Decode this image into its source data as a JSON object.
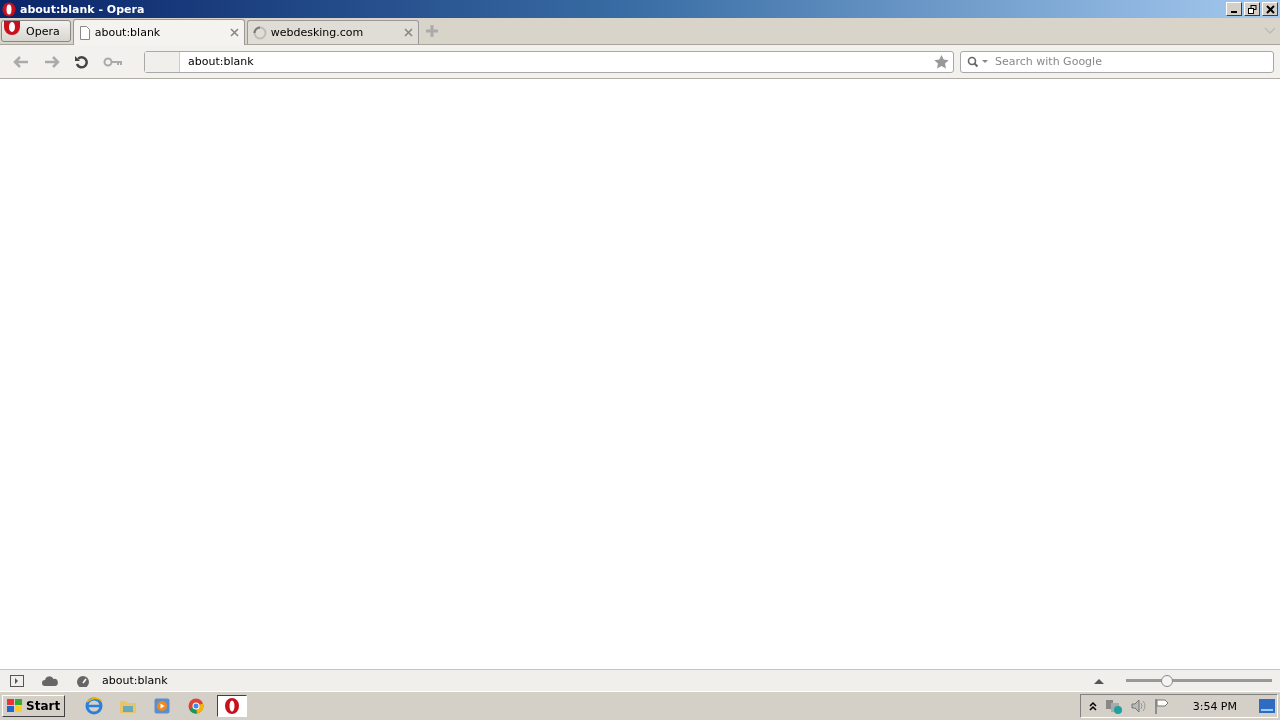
{
  "window": {
    "title": "about:blank - Opera"
  },
  "menu_button": {
    "label": "Opera"
  },
  "tabs": [
    {
      "title": "about:blank",
      "kind": "page",
      "selected": true
    },
    {
      "title": "webdesking.com",
      "kind": "loading",
      "selected": false
    }
  ],
  "address_bar": {
    "value": "about:blank"
  },
  "search": {
    "placeholder": "Search with Google"
  },
  "status_bar": {
    "text": "about:blank",
    "zoom": {
      "level": 0.28
    }
  },
  "taskbar": {
    "start": "Start",
    "apps": [
      {
        "kind": "ie",
        "selected": false
      },
      {
        "kind": "folder",
        "selected": false
      },
      {
        "kind": "media",
        "selected": false
      },
      {
        "kind": "chrome",
        "selected": false
      },
      {
        "kind": "opera",
        "selected": true
      }
    ],
    "clock": "3:54 PM"
  }
}
